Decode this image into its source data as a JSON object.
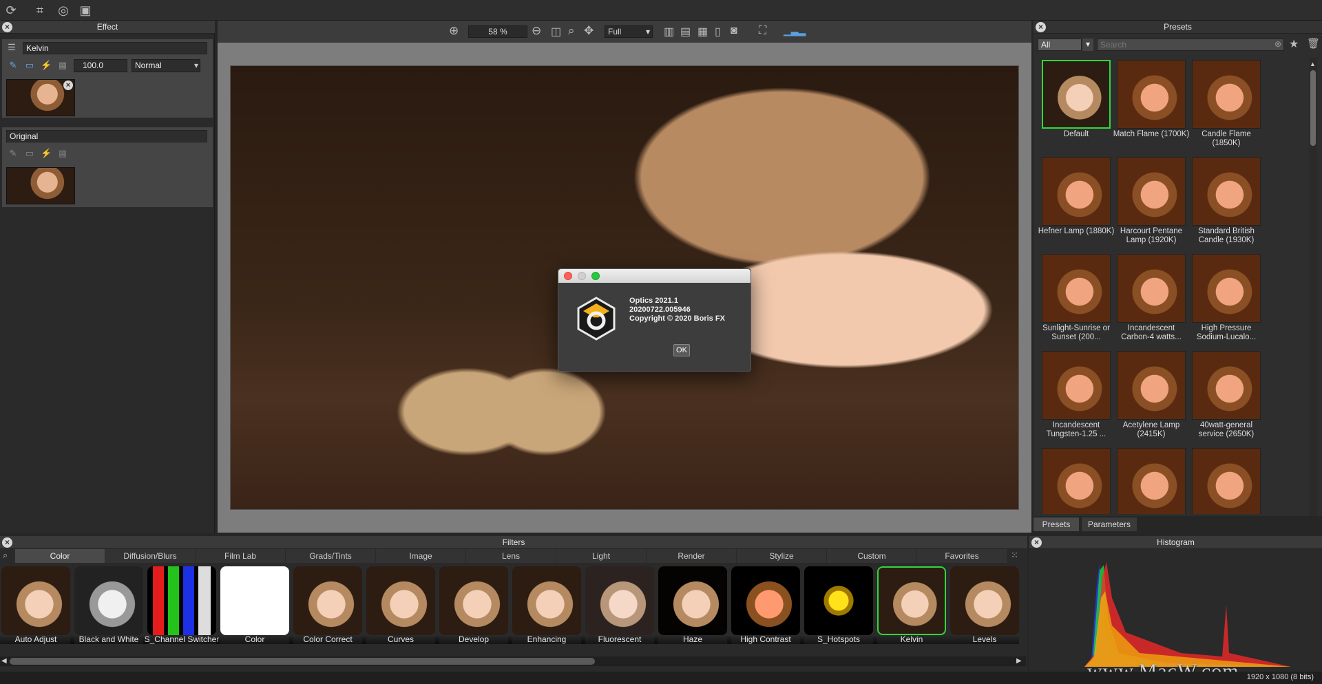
{
  "toolbar": {
    "icons": [
      "sync-icon",
      "crop-icon",
      "transform-icon",
      "fit-icon"
    ]
  },
  "effect_panel": {
    "title": "Effect",
    "layers": [
      {
        "name": "Kelvin",
        "opacity": "100.0",
        "blend_mode": "Normal"
      },
      {
        "name": "Original"
      }
    ]
  },
  "viewer": {
    "zoom": "58 %",
    "view_mode": "Full"
  },
  "about_dialog": {
    "line1": "Optics 2021.1",
    "line2": "20200722.005946",
    "line3": "Copyright © 2020 Boris FX",
    "ok_label": "OK"
  },
  "presets_panel": {
    "title": "Presets",
    "category": "All",
    "search_placeholder": "Search",
    "items": [
      "Default",
      "Match Flame (1700K)",
      "Candle Flame (1850K)",
      "Hefner Lamp (1880K)",
      "Harcourt Pentane Lamp (1920K)",
      "Standard British Candle (1930K)",
      "Sunlight-Sunrise or Sunset (200...",
      "Incandescent Carbon-4 watts...",
      "High Pressure Sodium-Lucalo...",
      "Incandescent Tungsten-1.25 ...",
      "Acetylene Lamp (2415K)",
      "40watt-general service (2650K)",
      "",
      "",
      ""
    ],
    "tabs": [
      "Presets",
      "Parameters"
    ]
  },
  "filters_panel": {
    "title": "Filters",
    "tabs": [
      "Color",
      "Diffusion/Blurs",
      "Film Lab",
      "Grads/Tints",
      "Image",
      "Lens",
      "Light",
      "Render",
      "Stylize",
      "Custom",
      "Favorites"
    ],
    "items": [
      "Auto Adjust",
      "Black and White",
      "S_Channel Switcher",
      "Color",
      "Color Correct",
      "Curves",
      "Develop",
      "Enhancing",
      "Fluorescent",
      "Haze",
      "High Contrast",
      "S_Hotspots",
      "Kelvin",
      "Levels"
    ]
  },
  "histogram_panel": {
    "title": "Histogram",
    "resolution": "1920 x 1080 (8 bits)"
  },
  "watermark": "www.MacW.com"
}
